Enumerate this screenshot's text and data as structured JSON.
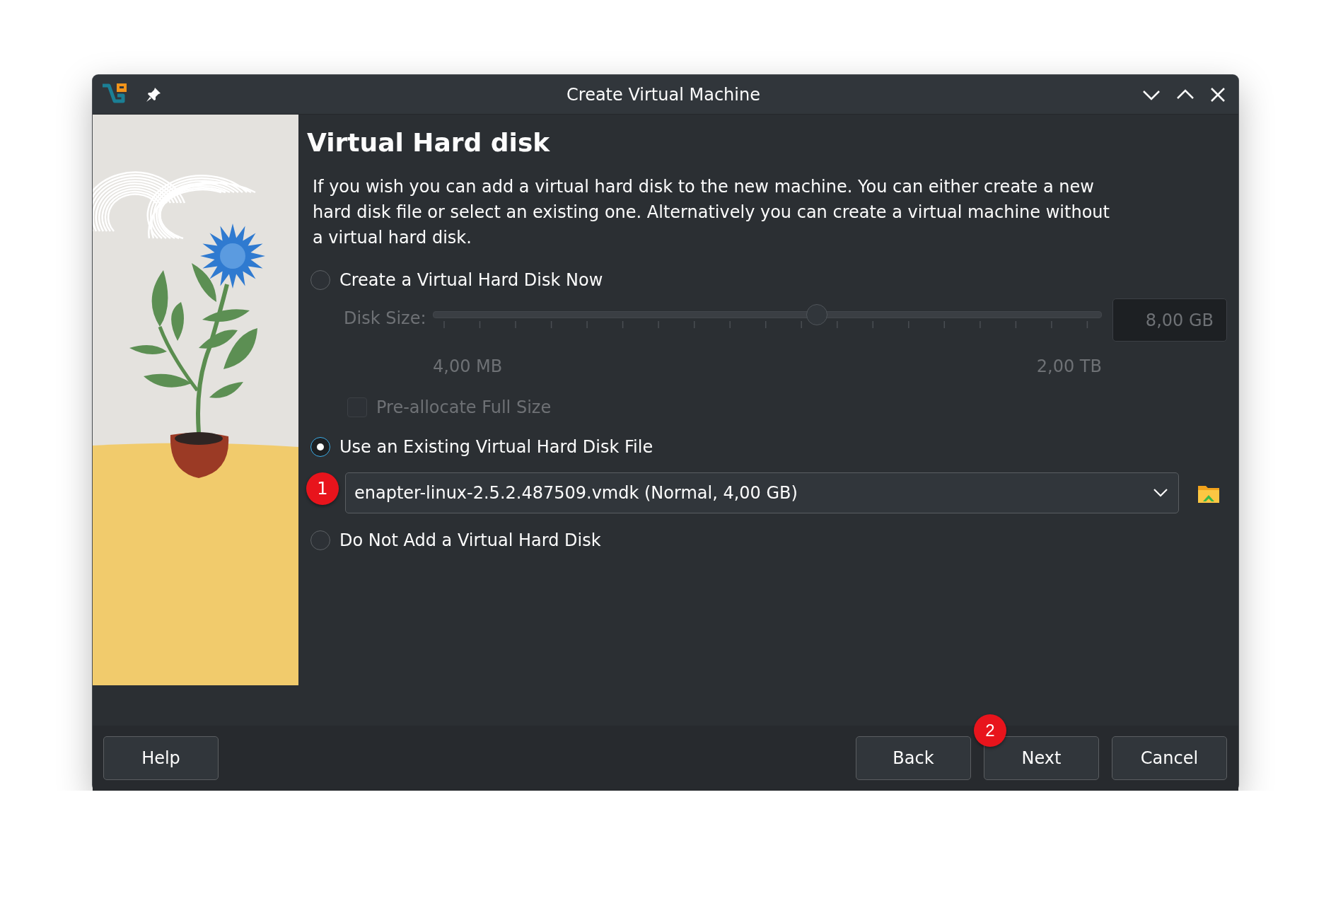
{
  "window": {
    "title": "Create Virtual Machine"
  },
  "page": {
    "title": "Virtual Hard disk",
    "description": "If you wish you can add a virtual hard disk to the new machine. You can either create a new hard disk file or select an existing one. Alternatively you can create a virtual machine without a virtual hard disk."
  },
  "disk_options": [
    {
      "label": "Create a Virtual Hard Disk Now",
      "selected": false
    },
    {
      "label": "Use an Existing Virtual Hard Disk File",
      "selected": true
    },
    {
      "label": "Do Not Add a Virtual Hard Disk",
      "selected": false
    }
  ],
  "disk_size": {
    "label": "Disk Size:",
    "level": 0.574,
    "value": "8,00 GB",
    "min_label": "4,00 MB",
    "max_label": "2,00 TB",
    "disabled": true
  },
  "preallocate": {
    "label": "Pre-allocate Full Size",
    "checked": false,
    "disabled": true
  },
  "disk_file": {
    "value": "enapter-linux-2.5.2.487509.vmdk (Normal, 4,00 GB)",
    "badge": "1"
  },
  "buttons": [
    {
      "label": "Help"
    },
    {
      "label": "Back"
    },
    {
      "label": "Next",
      "badge": "2"
    },
    {
      "label": "Cancel"
    }
  ]
}
